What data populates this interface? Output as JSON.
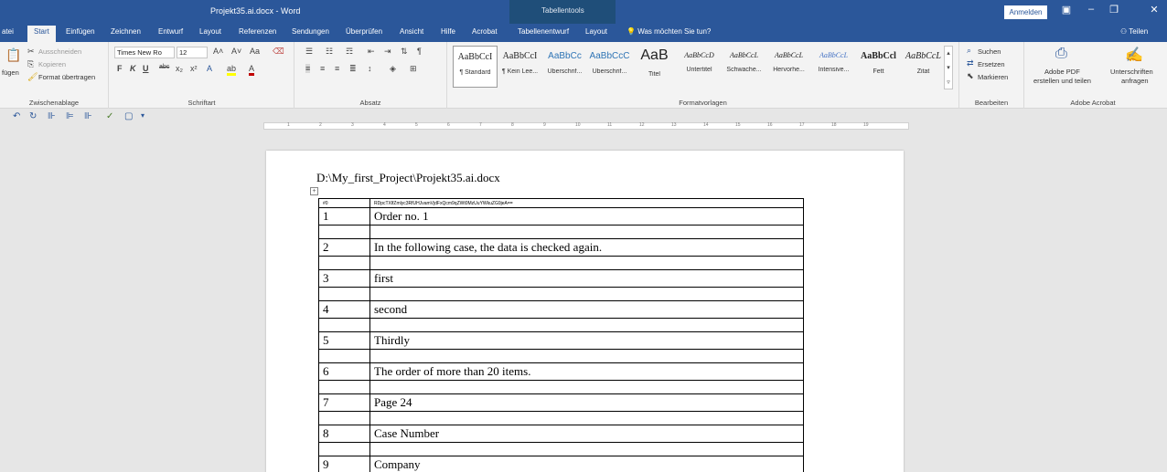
{
  "title_bar": {
    "document_title": "Projekt35.ai.docx - Word",
    "contextual_label": "Tabellentools",
    "sign_in": "Anmelden"
  },
  "tabs": {
    "file": "atei",
    "start": "Start",
    "insert": "Einfügen",
    "draw": "Zeichnen",
    "design": "Entwurf",
    "layout": "Layout",
    "references": "Referenzen",
    "mailings": "Sendungen",
    "review": "Überprüfen",
    "view": "Ansicht",
    "help": "Hilfe",
    "acrobat": "Acrobat",
    "table_design": "Tabellenentwurf",
    "table_layout": "Layout",
    "tell_me": "Was möchten Sie tun?",
    "share": "Teilen"
  },
  "ribbon": {
    "clipboard": {
      "paste": "fügen",
      "cut": "Ausschneiden",
      "copy": "Kopieren",
      "format_painter": "Format übertragen",
      "label": "Zwischenablage"
    },
    "font": {
      "font_name": "Times New Ro",
      "font_size": "12",
      "label": "Schriftart"
    },
    "paragraph": {
      "label": "Absatz"
    },
    "styles": {
      "label": "Formatvorlagen",
      "items": [
        {
          "sample": "AaBbCcI",
          "name": "¶ Standard"
        },
        {
          "sample": "AaBbCcI",
          "name": "¶ Kein Lee..."
        },
        {
          "sample": "AaBbCc",
          "name": "Überschrif..."
        },
        {
          "sample": "AaBbCcC",
          "name": "Überschrif..."
        },
        {
          "sample": "AaB",
          "name": "Titel"
        },
        {
          "sample": "AaBbCcD",
          "name": "Untertitel"
        },
        {
          "sample": "AaBbCcL",
          "name": "Schwache..."
        },
        {
          "sample": "AaBbCcL",
          "name": "Hervorhe..."
        },
        {
          "sample": "AaBbCcL",
          "name": "Intensive..."
        },
        {
          "sample": "AaBbCcl",
          "name": "Fett"
        },
        {
          "sample": "AaBbCcL",
          "name": "Zitat"
        }
      ]
    },
    "editing": {
      "find": "Suchen",
      "replace": "Ersetzen",
      "select": "Markieren",
      "label": "Bearbeiten"
    },
    "acrobat": {
      "create_pdf_line1": "Adobe PDF",
      "create_pdf_line2": "erstellen und teilen",
      "signatures_line1": "Unterschriften",
      "signatures_line2": "anfragen",
      "label": "Adobe Acrobat"
    }
  },
  "document": {
    "path": "D:\\My_first_Project\\Projekt35.ai.docx",
    "table_header": [
      "#0",
      "RDpcTXlfZmlyc3RfUHJvamVjdFxQcm9qZWt0MzUuYWkuZG9jeA=="
    ],
    "rows": [
      {
        "num": "1",
        "text": "Order no. 1"
      },
      {
        "num": "2",
        "text": "In the following case, the data is checked again."
      },
      {
        "num": "3",
        "text": "first"
      },
      {
        "num": "4",
        "text": "second"
      },
      {
        "num": "5",
        "text": "Thirdly"
      },
      {
        "num": "6",
        "text": "The order of more than 20 items."
      },
      {
        "num": "7",
        "text": "Page 24"
      },
      {
        "num": "8",
        "text": "Case Number"
      },
      {
        "num": "9",
        "text": "Company"
      }
    ]
  }
}
